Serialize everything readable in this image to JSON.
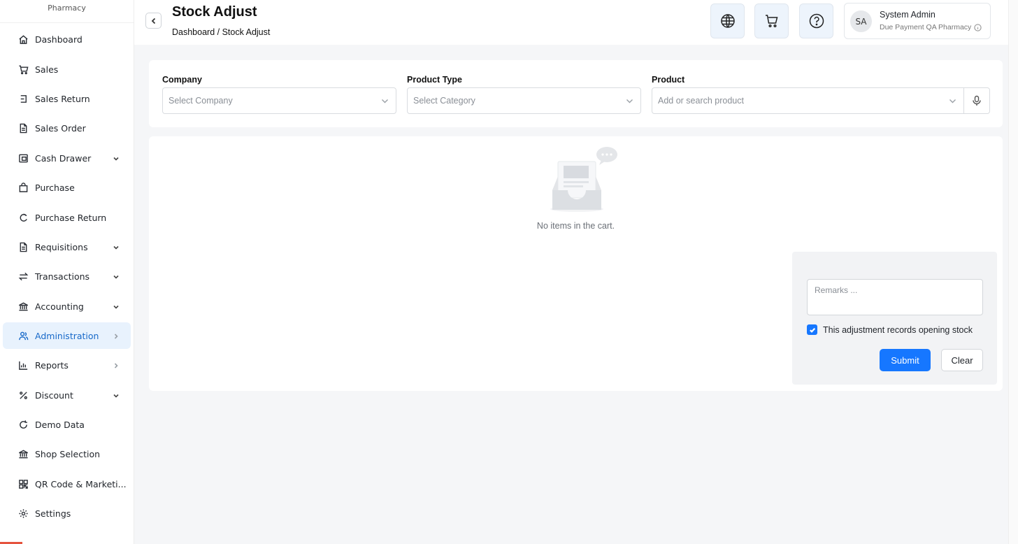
{
  "sidebar": {
    "brand": "Pharmacy",
    "items": [
      {
        "label": "Dashboard",
        "icon": "home-icon",
        "chevron": "none"
      },
      {
        "label": "Sales",
        "icon": "cart-icon",
        "chevron": "none"
      },
      {
        "label": "Sales Return",
        "icon": "return-icon",
        "chevron": "none"
      },
      {
        "label": "Sales Order",
        "icon": "document-icon",
        "chevron": "none"
      },
      {
        "label": "Cash Drawer",
        "icon": "drawer-icon",
        "chevron": "down"
      },
      {
        "label": "Purchase",
        "icon": "bag-icon",
        "chevron": "none"
      },
      {
        "label": "Purchase Return",
        "icon": "refresh-icon",
        "chevron": "none"
      },
      {
        "label": "Requisitions",
        "icon": "document-icon",
        "chevron": "down"
      },
      {
        "label": "Transactions",
        "icon": "swap-icon",
        "chevron": "down"
      },
      {
        "label": "Accounting",
        "icon": "bank-icon",
        "chevron": "down"
      },
      {
        "label": "Administration",
        "icon": "users-icon",
        "chevron": "right"
      },
      {
        "label": "Reports",
        "icon": "bar-chart-icon",
        "chevron": "right"
      },
      {
        "label": "Discount",
        "icon": "percent-icon",
        "chevron": "down"
      },
      {
        "label": "Demo Data",
        "icon": "reload-icon",
        "chevron": "none"
      },
      {
        "label": "Shop Selection",
        "icon": "bank-icon",
        "chevron": "none"
      },
      {
        "label": "QR Code & Marketi...",
        "icon": "qr-icon",
        "chevron": "none"
      },
      {
        "label": "Settings",
        "icon": "gear-icon",
        "chevron": "none"
      }
    ],
    "active_item": "Administration"
  },
  "header": {
    "title": "Stock Adjust",
    "breadcrumb": "Dashboard / Stock Adjust",
    "icons": [
      "globe-icon",
      "cart-icon",
      "help-icon"
    ],
    "user": {
      "initials": "SA",
      "name": "System Admin",
      "subtitle": "Due Payment QA Pharmacy"
    }
  },
  "filters": {
    "company": {
      "label": "Company",
      "placeholder": "Select Company"
    },
    "product_type": {
      "label": "Product Type",
      "placeholder": "Select Category"
    },
    "product": {
      "label": "Product",
      "placeholder": "Add or search product"
    }
  },
  "cart": {
    "empty_message": "No items in the cart."
  },
  "adjustment": {
    "remarks_placeholder": "Remarks ...",
    "opening_stock_label": "This adjustment records opening stock",
    "opening_stock_checked": true,
    "submit_label": "Submit",
    "clear_label": "Clear"
  },
  "colors": {
    "accent": "#1677ff",
    "active_bg": "#e8f2fd",
    "active_text": "#1769c9"
  }
}
